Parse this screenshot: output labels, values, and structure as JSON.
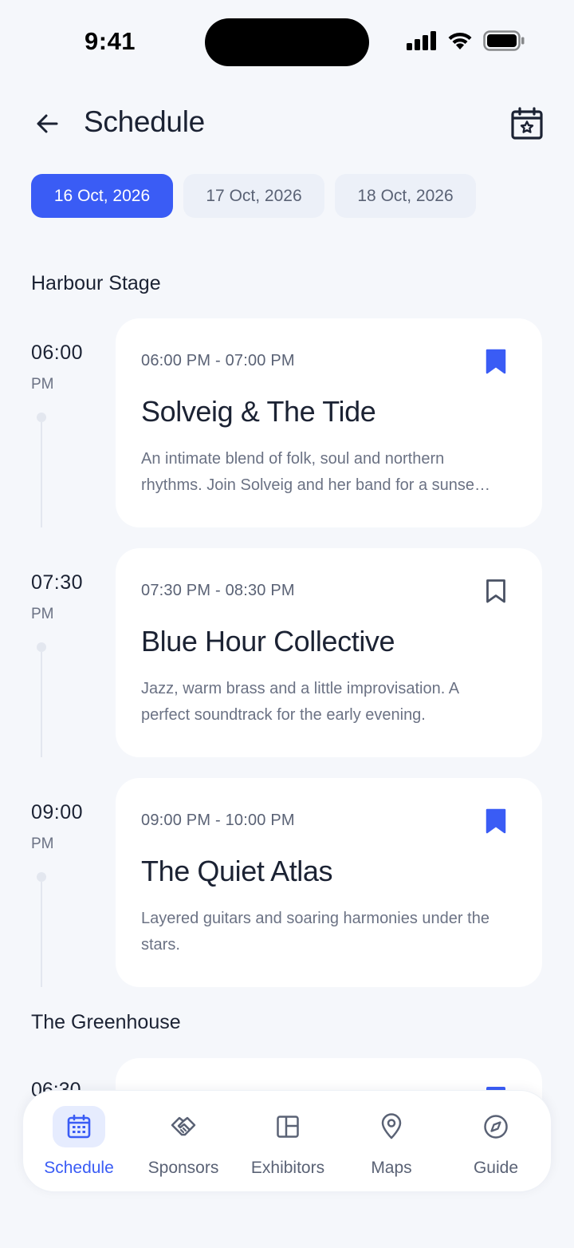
{
  "status_bar": {
    "time": "9:41"
  },
  "header": {
    "title": "Schedule"
  },
  "date_tabs": [
    {
      "label": "16 Oct, 2026",
      "active": true
    },
    {
      "label": "17 Oct, 2026",
      "active": false
    },
    {
      "label": "18 Oct, 2026",
      "active": false
    }
  ],
  "sections": [
    {
      "title": "Harbour Stage",
      "events": [
        {
          "time": "06:00",
          "ampm": "PM",
          "range": "06:00 PM - 07:00 PM",
          "title": "Solveig & The Tide",
          "description": "An intimate blend of folk, soul and northern rhythms. Join Solveig and her band for a sunse…",
          "bookmarked": true
        },
        {
          "time": "07:30",
          "ampm": "PM",
          "range": "07:30 PM - 08:30 PM",
          "title": "Blue Hour Collective",
          "description": "Jazz, warm brass and a little improvisation. A perfect soundtrack for the early evening.",
          "bookmarked": false
        },
        {
          "time": "09:00",
          "ampm": "PM",
          "range": "09:00 PM - 10:00 PM",
          "title": "The Quiet Atlas",
          "description": "Layered guitars and soaring harmonies under the stars.",
          "bookmarked": true
        }
      ]
    },
    {
      "title": "The Greenhouse",
      "events": [
        {
          "time": "06:30"
        }
      ]
    }
  ],
  "bottom_nav": [
    {
      "label": "Schedule",
      "icon": "calendar-icon",
      "active": true
    },
    {
      "label": "Sponsors",
      "icon": "handshake-icon",
      "active": false
    },
    {
      "label": "Exhibitors",
      "icon": "layout-icon",
      "active": false
    },
    {
      "label": "Maps",
      "icon": "map-pin-icon",
      "active": false
    },
    {
      "label": "Guide",
      "icon": "compass-icon",
      "active": false
    }
  ],
  "colors": {
    "accent": "#3a5cf5",
    "background": "#f5f7fb",
    "card": "#ffffff",
    "text_primary": "#1b2233",
    "text_secondary": "#6b7284"
  }
}
